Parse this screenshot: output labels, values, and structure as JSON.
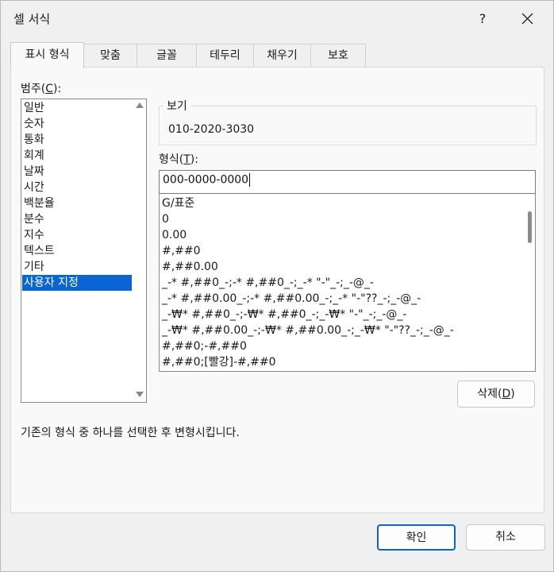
{
  "window": {
    "title": "셀 서식",
    "help_glyph": "?",
    "close_icon": "close-icon"
  },
  "tabs": [
    {
      "label": "표시 형식",
      "active": true
    },
    {
      "label": "맞춤"
    },
    {
      "label": "글꼴"
    },
    {
      "label": "테두리"
    },
    {
      "label": "채우기"
    },
    {
      "label": "보호"
    }
  ],
  "category": {
    "label_prefix": "범주(",
    "label_key": "C",
    "label_suffix": "):",
    "items": [
      "일반",
      "숫자",
      "통화",
      "회계",
      "날짜",
      "시간",
      "백분율",
      "분수",
      "지수",
      "텍스트",
      "기타",
      "사용자 지정"
    ],
    "selected_index": 11
  },
  "sample": {
    "legend": "보기",
    "value": "010-2020-3030"
  },
  "format": {
    "label_prefix": "형식(",
    "label_key": "T",
    "label_suffix": "):",
    "value": "000-0000-0000",
    "list": [
      "G/표준",
      "0",
      "0.00",
      "#,##0",
      "#,##0.00",
      "_-* #,##0_-;-* #,##0_-;_-* \"-\"_-;_-@_-",
      "_-* #,##0.00_-;-* #,##0.00_-;_-* \"-\"??_-;_-@_-",
      "_-₩* #,##0_-;-₩* #,##0_-;_-₩* \"-\"_-;_-@_-",
      "_-₩* #,##0.00_-;-₩* #,##0.00_-;_-₩* \"-\"??_-;_-@_-",
      "#,##0;-#,##0",
      "#,##0;[빨강]-#,##0"
    ]
  },
  "delete_button": {
    "prefix": "삭제(",
    "key": "D",
    "suffix": ")"
  },
  "description": "기존의 형식 중 하나를 선택한 후 변형시킵니다.",
  "footer": {
    "ok": "확인",
    "cancel": "취소"
  },
  "colors": {
    "accent": "#0a64d2"
  }
}
